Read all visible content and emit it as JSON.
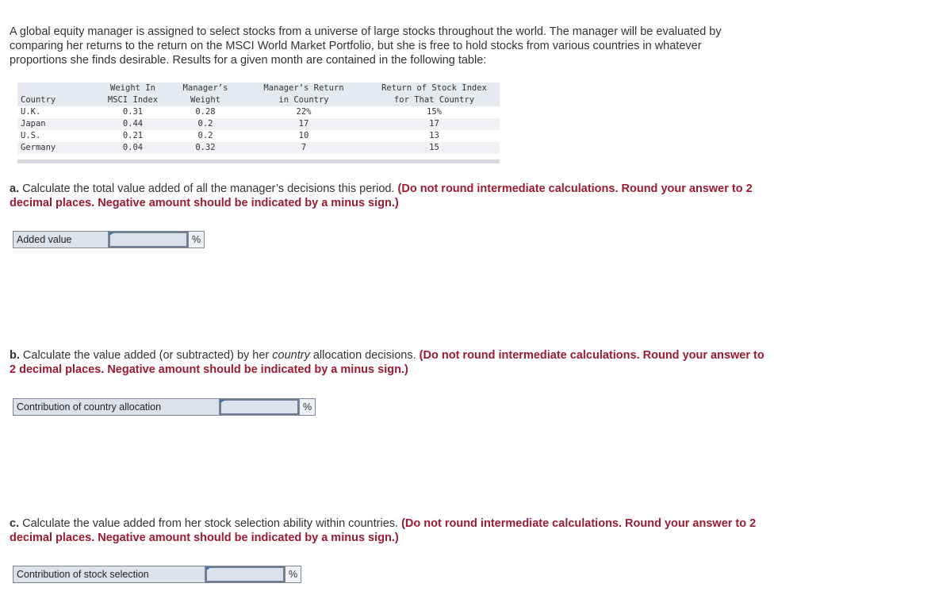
{
  "intro": "A global equity manager is assigned to select stocks from a universe of large stocks throughout the world. The manager will be evaluated by comparing her returns to the return on the MSCI World Market Portfolio, but she is free to hold stocks from various countries in whatever proportions she finds desirable. Results for a given month are contained in the following table:",
  "table": {
    "headers": [
      "Country",
      "Weight In\nMSCI Index",
      "Manager’s\nWeight",
      "Manager’s Return\nin Country",
      "Return of Stock Index\nfor That Country"
    ],
    "rows": [
      [
        "U.K.",
        "0.31",
        "0.28",
        "22%",
        "15%"
      ],
      [
        "Japan",
        "0.44",
        "0.2",
        "17",
        "17"
      ],
      [
        "U.S.",
        "0.21",
        "0.2",
        "10",
        "13"
      ],
      [
        "Germany",
        "0.04",
        "0.32",
        "7",
        "15"
      ]
    ]
  },
  "questions": [
    {
      "letter": "a.",
      "text_before": " Calculate the total value added of all the manager’s decisions this period. ",
      "italic": "",
      "text_after": "",
      "note": "(Do not round intermediate calculations. Round your answer to 2 decimal places. Negative amount should be indicated by a minus sign.)",
      "field_label": "Added value",
      "field_value": "",
      "unit": "%"
    },
    {
      "letter": "b.",
      "text_before": " Calculate the value added (or subtracted) by her ",
      "italic": "country",
      "text_after": " allocation decisions. ",
      "note": "(Do not round intermediate calculations. Round your answer to 2 decimal places. Negative amount should be indicated by a minus sign.)",
      "field_label": "Contribution of country allocation",
      "field_value": "",
      "unit": "%"
    },
    {
      "letter": "c.",
      "text_before": " Calculate the value added from her stock selection ability within countries. ",
      "italic": "",
      "text_after": "",
      "note": "(Do not round intermediate calculations. Round your answer to 2 decimal places. Negative amount should be indicated by a minus sign.)",
      "field_label": "Contribution of stock selection",
      "field_value": "",
      "unit": "%"
    }
  ]
}
